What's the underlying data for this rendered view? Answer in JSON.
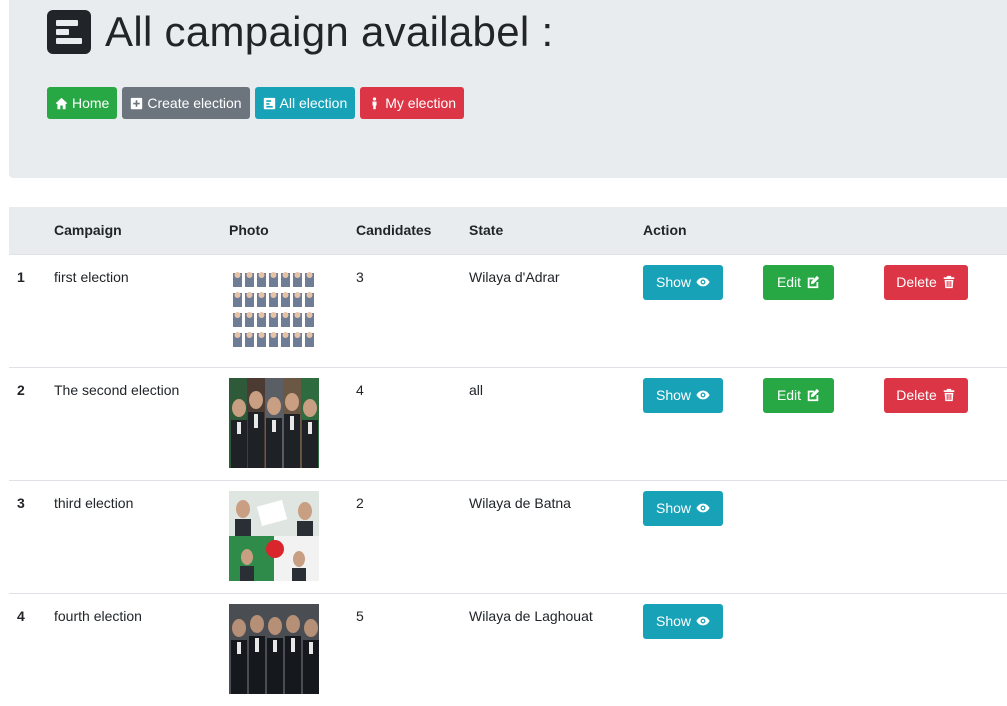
{
  "header": {
    "title": "All campaign availabel :",
    "icon": "poll-icon"
  },
  "nav": {
    "home": "Home",
    "create": "Create election",
    "all": "All election",
    "my": "My election"
  },
  "table": {
    "headers": [
      "Campaign",
      "Photo",
      "Candidates",
      "State",
      "Action"
    ],
    "show_label": "Show",
    "edit_label": "Edit",
    "delete_label": "Delete",
    "rows": [
      {
        "index": "1",
        "campaign": "first election",
        "candidates": "3",
        "state": "Wilaya d'Adrar",
        "photo": "candidates-grid-photo",
        "actions": [
          "show",
          "edit",
          "delete"
        ]
      },
      {
        "index": "2",
        "campaign": "The second election",
        "candidates": "4",
        "state": "all",
        "photo": "candidates-group-photo",
        "actions": [
          "show",
          "edit",
          "delete"
        ]
      },
      {
        "index": "3",
        "campaign": "third election",
        "candidates": "2",
        "state": "Wilaya de Batna",
        "photo": "vote-collage-photo",
        "actions": [
          "show"
        ]
      },
      {
        "index": "4",
        "campaign": "fourth election",
        "candidates": "5",
        "state": "Wilaya de Laghouat",
        "photo": "candidates-lineup-photo",
        "actions": [
          "show"
        ]
      }
    ]
  },
  "colors": {
    "green": "#28a745",
    "gray": "#6c757d",
    "teal": "#17a2b8",
    "red": "#dc3545",
    "jumbotron": "#e9ecef"
  }
}
